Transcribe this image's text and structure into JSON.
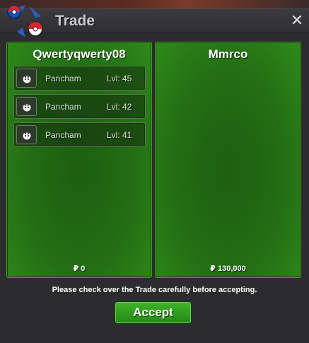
{
  "window": {
    "title": "Trade",
    "close_label": "✕"
  },
  "trade": {
    "left": {
      "player_name": "Qwertyqwerty08",
      "money": "₽ 0",
      "items": [
        {
          "name": "Pancham",
          "level": "Lvl: 45",
          "icon": "pancham-icon"
        },
        {
          "name": "Pancham",
          "level": "Lvl: 42",
          "icon": "pancham-icon"
        },
        {
          "name": "Pancham",
          "level": "Lvl: 41",
          "icon": "pancham-icon"
        }
      ]
    },
    "right": {
      "player_name": "Mmrco",
      "money": "₽ 130,000",
      "items": []
    }
  },
  "footer": {
    "notice": "Please check over the Trade carefully before accepting.",
    "accept_label": "Accept"
  },
  "colors": {
    "panel_green": "#246e14",
    "panel_border": "#3fa62a",
    "accept_green": "#2f9e1e",
    "window_bg": "#2c2c2e"
  }
}
